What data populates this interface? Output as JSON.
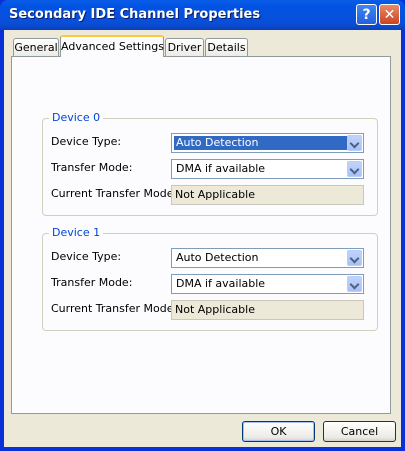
{
  "window": {
    "title": "Secondary IDE Channel Properties"
  },
  "titlebar": {
    "help_label": "?",
    "close_label": "✕"
  },
  "tabs": [
    {
      "label": "General"
    },
    {
      "label": "Advanced Settings",
      "active": true
    },
    {
      "label": "Driver"
    },
    {
      "label": "Details"
    }
  ],
  "devices": [
    {
      "title": "Device 0",
      "device_type_label": "Device Type:",
      "device_type_value": "Auto Detection",
      "transfer_mode_label": "Transfer Mode:",
      "transfer_mode_value": "DMA if available",
      "current_mode_label": "Current Transfer Mode:",
      "current_mode_value": "Not Applicable"
    },
    {
      "title": "Device 1",
      "device_type_label": "Device Type:",
      "device_type_value": "Auto Detection",
      "transfer_mode_label": "Transfer Mode:",
      "transfer_mode_value": "DMA if available",
      "current_mode_label": "Current Transfer Mode:",
      "current_mode_value": "Not Applicable"
    }
  ],
  "buttons": {
    "ok": "OK",
    "cancel": "Cancel"
  },
  "colors": {
    "titlebar": "#0a4ed7",
    "group_title": "#0046d5",
    "selection": "#316ac5",
    "dialog_bg": "#ece9d8"
  }
}
